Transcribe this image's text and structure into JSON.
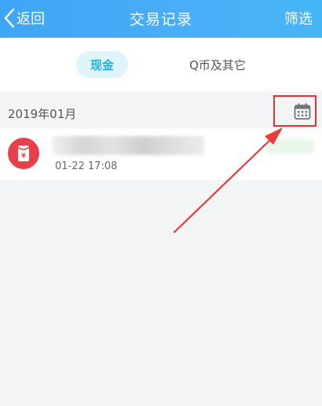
{
  "header": {
    "back_label": "返回",
    "title": "交易记录",
    "filter_label": "筛选"
  },
  "tabs": [
    {
      "label": "现金",
      "selected": true
    },
    {
      "label": "Q币及其它",
      "selected": false
    }
  ],
  "month": {
    "label": "2019年01月"
  },
  "records": [
    {
      "time": "01-22 17:08",
      "icon": "red-envelope-icon"
    }
  ],
  "colors": {
    "header_accent": "#45aaf7",
    "tab_selected_text": "#1eb2d8",
    "highlight": "#e53232",
    "envelope": "#e8404a"
  },
  "icons": {
    "back": "chevron-left-icon",
    "calendar": "calendar-icon",
    "record": "red-envelope-icon"
  }
}
